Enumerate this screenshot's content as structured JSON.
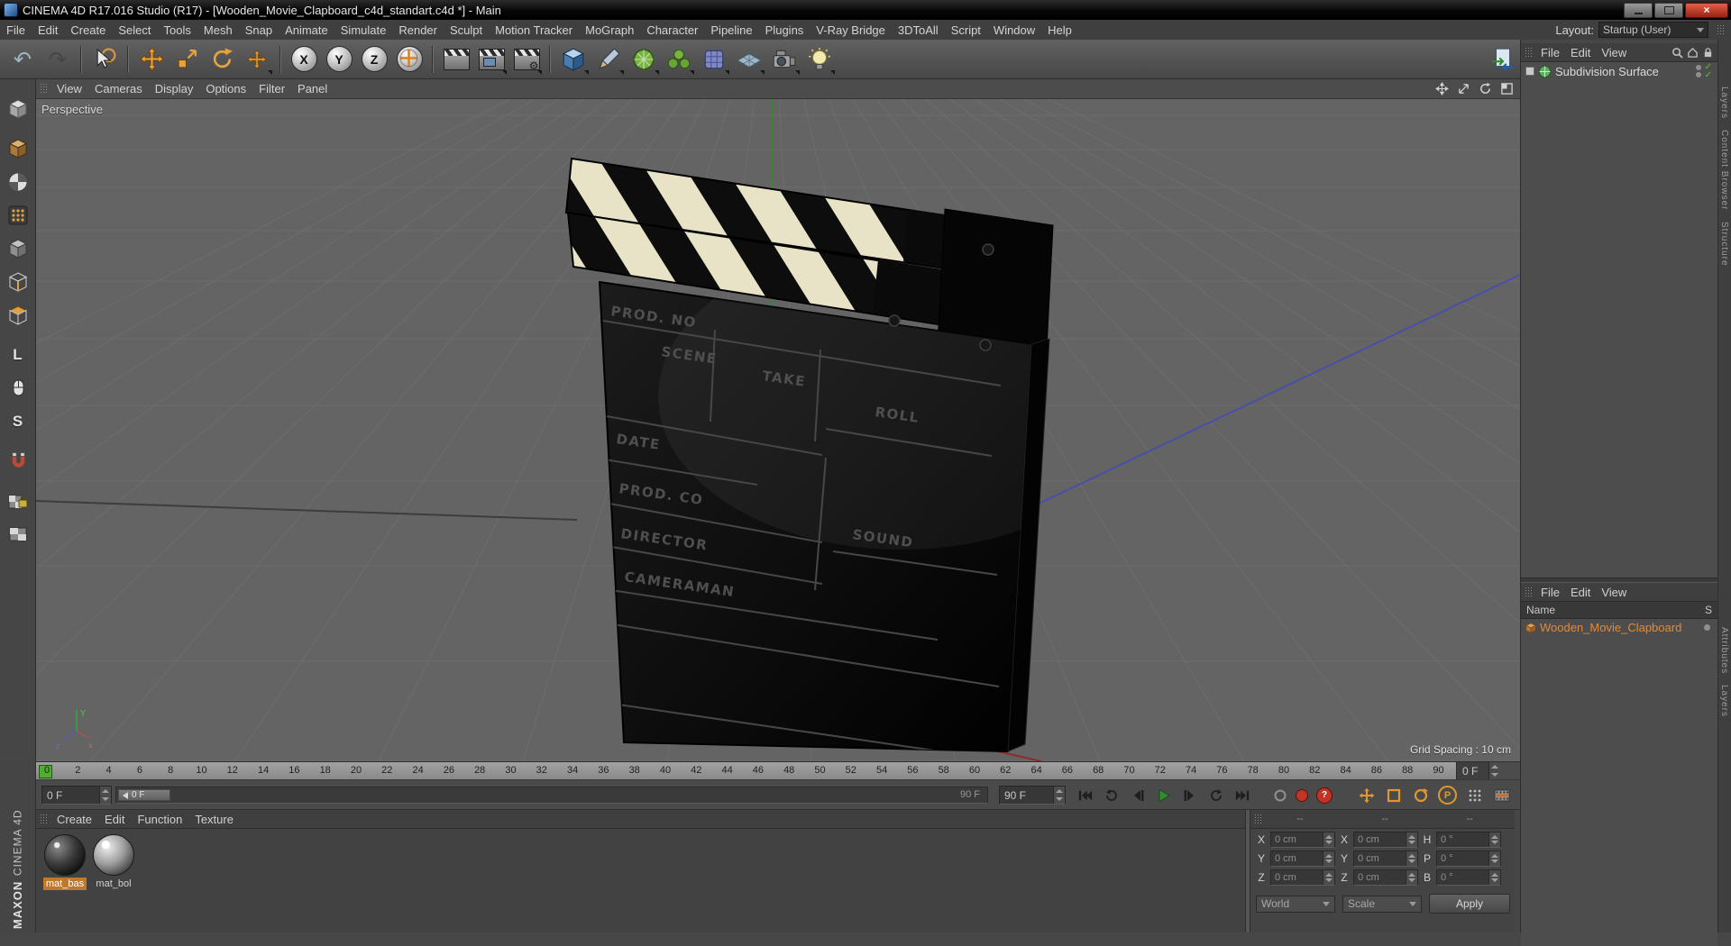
{
  "window": {
    "title": "CINEMA 4D R17.016 Studio (R17) - [Wooden_Movie_Clapboard_c4d_standart.c4d *] - Main"
  },
  "menubar": {
    "items": [
      "File",
      "Edit",
      "Create",
      "Select",
      "Tools",
      "Mesh",
      "Snap",
      "Animate",
      "Simulate",
      "Render",
      "Sculpt",
      "Motion Tracker",
      "MoGraph",
      "Character",
      "Pipeline",
      "Plugins",
      "V-Ray Bridge",
      "3DToAll",
      "Script",
      "Window",
      "Help"
    ],
    "layout_label": "Layout:",
    "layout_value": "Startup (User)"
  },
  "toolbar": {
    "axis_buttons": [
      "X",
      "Y",
      "Z"
    ]
  },
  "left_toolbar": {
    "axis_label": "L",
    "snap_label": "S"
  },
  "viewport": {
    "menu": [
      "View",
      "Cameras",
      "Display",
      "Options",
      "Filter",
      "Panel"
    ],
    "camera_label": "Perspective",
    "grid_spacing": "Grid Spacing : 10 cm",
    "gizmo": {
      "x": "x",
      "y": "Y",
      "z": "z"
    },
    "clapboard_labels": {
      "prod_no": "PROD. NO",
      "scene": "SCENE",
      "take": "TAKE",
      "roll": "ROLL",
      "date": "DATE",
      "prod_co": "PROD. CO",
      "director": "DIRECTOR",
      "sound": "SOUND",
      "cameraman": "CAMERAMAN"
    }
  },
  "timeline": {
    "ticks": [
      0,
      2,
      4,
      6,
      8,
      10,
      12,
      14,
      16,
      18,
      20,
      22,
      24,
      26,
      28,
      30,
      32,
      34,
      36,
      38,
      40,
      42,
      44,
      46,
      48,
      50,
      52,
      54,
      56,
      58,
      60,
      62,
      64,
      66,
      68,
      70,
      72,
      74,
      76,
      78,
      80,
      82,
      84,
      86,
      88,
      90
    ],
    "ruler_value": "0 F",
    "current_frame_box": "0 F",
    "scrub_marker": "0 F",
    "scrub_end": "90 F",
    "end_frame_box": "90 F",
    "autokey_label": "?",
    "parameter_key_label": "P"
  },
  "materials": {
    "menu": [
      "Create",
      "Edit",
      "Function",
      "Texture"
    ],
    "items": [
      {
        "name": "mat_bas",
        "selected": true
      },
      {
        "name": "mat_bol",
        "selected": false
      }
    ]
  },
  "coordinates": {
    "handle_header": [
      "--",
      "--",
      "--"
    ],
    "rows": [
      [
        "X",
        "0 cm",
        "X",
        "0 cm",
        "H",
        "0 °"
      ],
      [
        "Y",
        "0 cm",
        "Y",
        "0 cm",
        "P",
        "0 °"
      ],
      [
        "Z",
        "0 cm",
        "Z",
        "0 cm",
        "B",
        "0 °"
      ]
    ],
    "mode1": "World",
    "mode2": "Scale",
    "apply": "Apply"
  },
  "object_manager": {
    "menu": [
      "File",
      "Edit",
      "View"
    ],
    "objects": [
      {
        "name": "Subdivision Surface"
      }
    ]
  },
  "scene_browser": {
    "menu": [
      "File",
      "Edit",
      "View"
    ],
    "name_header": "Name",
    "s_header": "S",
    "items": [
      {
        "name": "Wooden_Movie_Clapboard"
      }
    ]
  },
  "side_tabs": {
    "upper": [
      "Layers",
      "Content Browser",
      "Structure"
    ],
    "lower": [
      "Attributes",
      "Layers"
    ]
  },
  "branding": {
    "maxon": "MAXON",
    "cinema": "CINEMA 4D"
  }
}
